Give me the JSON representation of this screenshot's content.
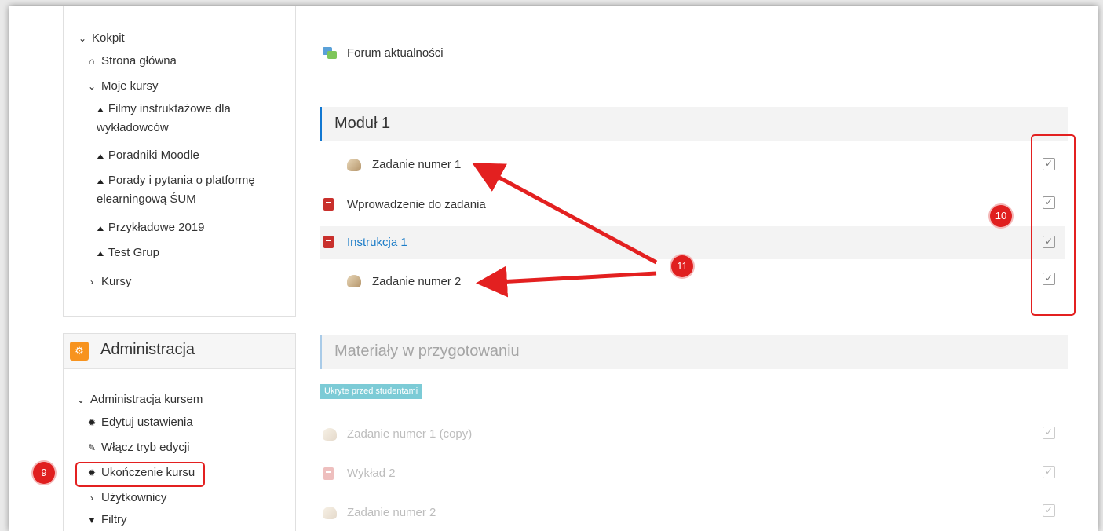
{
  "nav": {
    "kokpit": "Kokpit",
    "strona_glowna": "Strona główna",
    "moje_kursy": "Moje kursy",
    "courses": [
      "Filmy instruktażowe dla wykładowców",
      "Poradniki Moodle",
      "Porady i pytania o platformę elearningową ŚUM",
      "Przykładowe 2019",
      "Test Grup"
    ],
    "kursy": "Kursy"
  },
  "admin": {
    "title": "Administracja",
    "course_admin": "Administracja kursem",
    "items": [
      "Edytuj ustawienia",
      "Włącz tryb edycji",
      "Ukończenie kursu",
      "Użytkownicy",
      "Filtry"
    ]
  },
  "main": {
    "forum": "Forum aktualności",
    "module1": {
      "title": "Moduł 1",
      "items": [
        "Zadanie numer 1",
        "Wprowadzenie do zadania",
        "Instrukcja 1",
        "Zadanie numer 2"
      ]
    },
    "materials": {
      "title": "Materiały w przygotowaniu",
      "hidden_badge": "Ukryte przed studentami",
      "items": [
        "Zadanie numer 1 (copy)",
        "Wykład 2",
        "Zadanie numer 2"
      ]
    }
  },
  "annotations": {
    "badge_9": "9",
    "badge_10": "10",
    "badge_11": "11"
  },
  "colors": {
    "annotation_red": "#e32020",
    "link_blue": "#1d7dc8",
    "admin_orange": "#f7931e"
  }
}
